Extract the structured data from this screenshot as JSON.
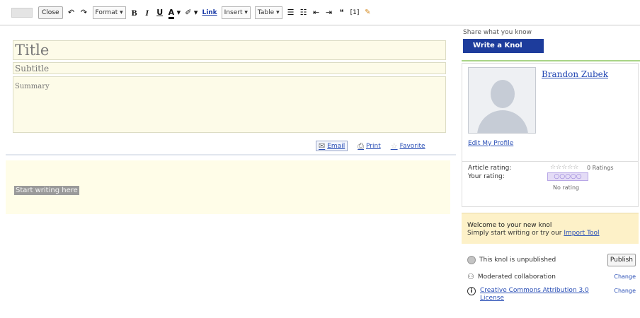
{
  "toolbar": {
    "close_label": "Close",
    "format_label": "Format",
    "bold": "B",
    "italic": "I",
    "underline": "U",
    "text_color": "A",
    "link_label": "Link",
    "insert_label": "Insert",
    "table_label": "Table",
    "dropdown_arrow": "▾",
    "undo_icon": "↶",
    "redo_icon": "↷",
    "highlight_icon": "✐",
    "numbered_list_icon": "☰",
    "bullet_list_icon": "☷",
    "indent_less_icon": "⇤",
    "indent_more_icon": "⇥",
    "quote_icon": "❝",
    "footnote_label": "[1]",
    "pen_icon": "✎"
  },
  "editor": {
    "title_placeholder": "Title",
    "subtitle_placeholder": "Subtitle",
    "summary_placeholder": "Summary",
    "start_writing": "Start writing here"
  },
  "actions": {
    "email_label": "Email",
    "print_label": "Print",
    "favorite_label": "Favorite"
  },
  "sidebar": {
    "share_text": "Share what you know",
    "write_button": "Write a Knol",
    "author_name": "Brandon Zubek",
    "profile_link": "Edit My Profile",
    "article_rating_label": "Article rating:",
    "article_rating_stars": "☆☆☆☆☆",
    "ratings_count": "0 Ratings",
    "your_rating_label": "Your rating:",
    "your_rating_stars": "○○○○○",
    "no_rating": "No rating",
    "welcome_title": "Welcome to your new knol",
    "welcome_prefix": "Simply start writing or try our",
    "import_link": "Import Tool",
    "unpublished_text": "This knol is unpublished",
    "publish_button": "Publish",
    "collab_text": "Moderated collaboration",
    "change_label": "Change",
    "license_symbol": "i",
    "license_text": "Creative Commons Attribution 3.0 License"
  }
}
